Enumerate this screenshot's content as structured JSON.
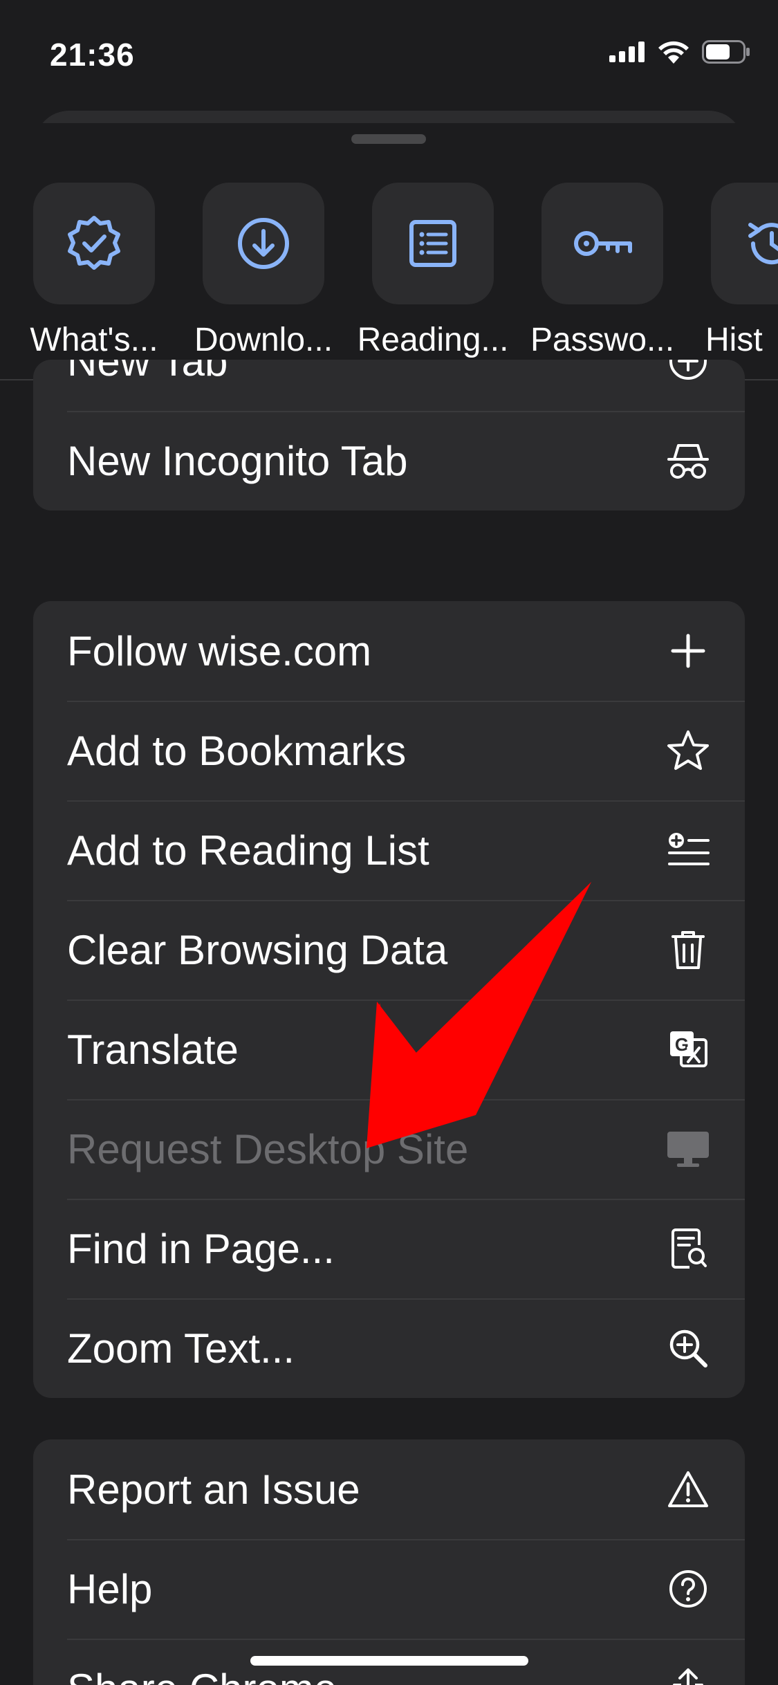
{
  "status": {
    "time": "21:36"
  },
  "quick_actions": [
    {
      "label": "What's...",
      "icon": "badge-check-icon"
    },
    {
      "label": "Downlo...",
      "icon": "download-icon"
    },
    {
      "label": "Reading...",
      "icon": "reading-list-icon"
    },
    {
      "label": "Passwo...",
      "icon": "key-icon"
    },
    {
      "label": "Hist",
      "icon": "history-icon"
    }
  ],
  "menu": {
    "group1": [
      {
        "label": "New Tab",
        "icon": "plus-circle-icon"
      },
      {
        "label": "New Incognito Tab",
        "icon": "incognito-icon"
      }
    ],
    "group2": [
      {
        "label": "Follow wise.com",
        "icon": "plus-icon"
      },
      {
        "label": "Add to Bookmarks",
        "icon": "star-icon"
      },
      {
        "label": "Add to Reading List",
        "icon": "reading-list-add-icon"
      },
      {
        "label": "Clear Browsing Data",
        "icon": "trash-icon"
      },
      {
        "label": "Translate",
        "icon": "translate-icon"
      },
      {
        "label": "Request Desktop Site",
        "icon": "desktop-icon",
        "disabled": true
      },
      {
        "label": "Find in Page...",
        "icon": "find-in-page-icon"
      },
      {
        "label": "Zoom Text...",
        "icon": "zoom-in-icon"
      }
    ],
    "group3": [
      {
        "label": "Report an Issue",
        "icon": "warning-icon"
      },
      {
        "label": "Help",
        "icon": "help-icon"
      },
      {
        "label": "Share Chrome...",
        "icon": "share-icon"
      }
    ]
  },
  "colors": {
    "background": "#1c1c1e",
    "card": "#2c2c2e",
    "accent": "#8ab4f8",
    "arrow": "#ff0000",
    "disabled": "#6d6d70"
  }
}
